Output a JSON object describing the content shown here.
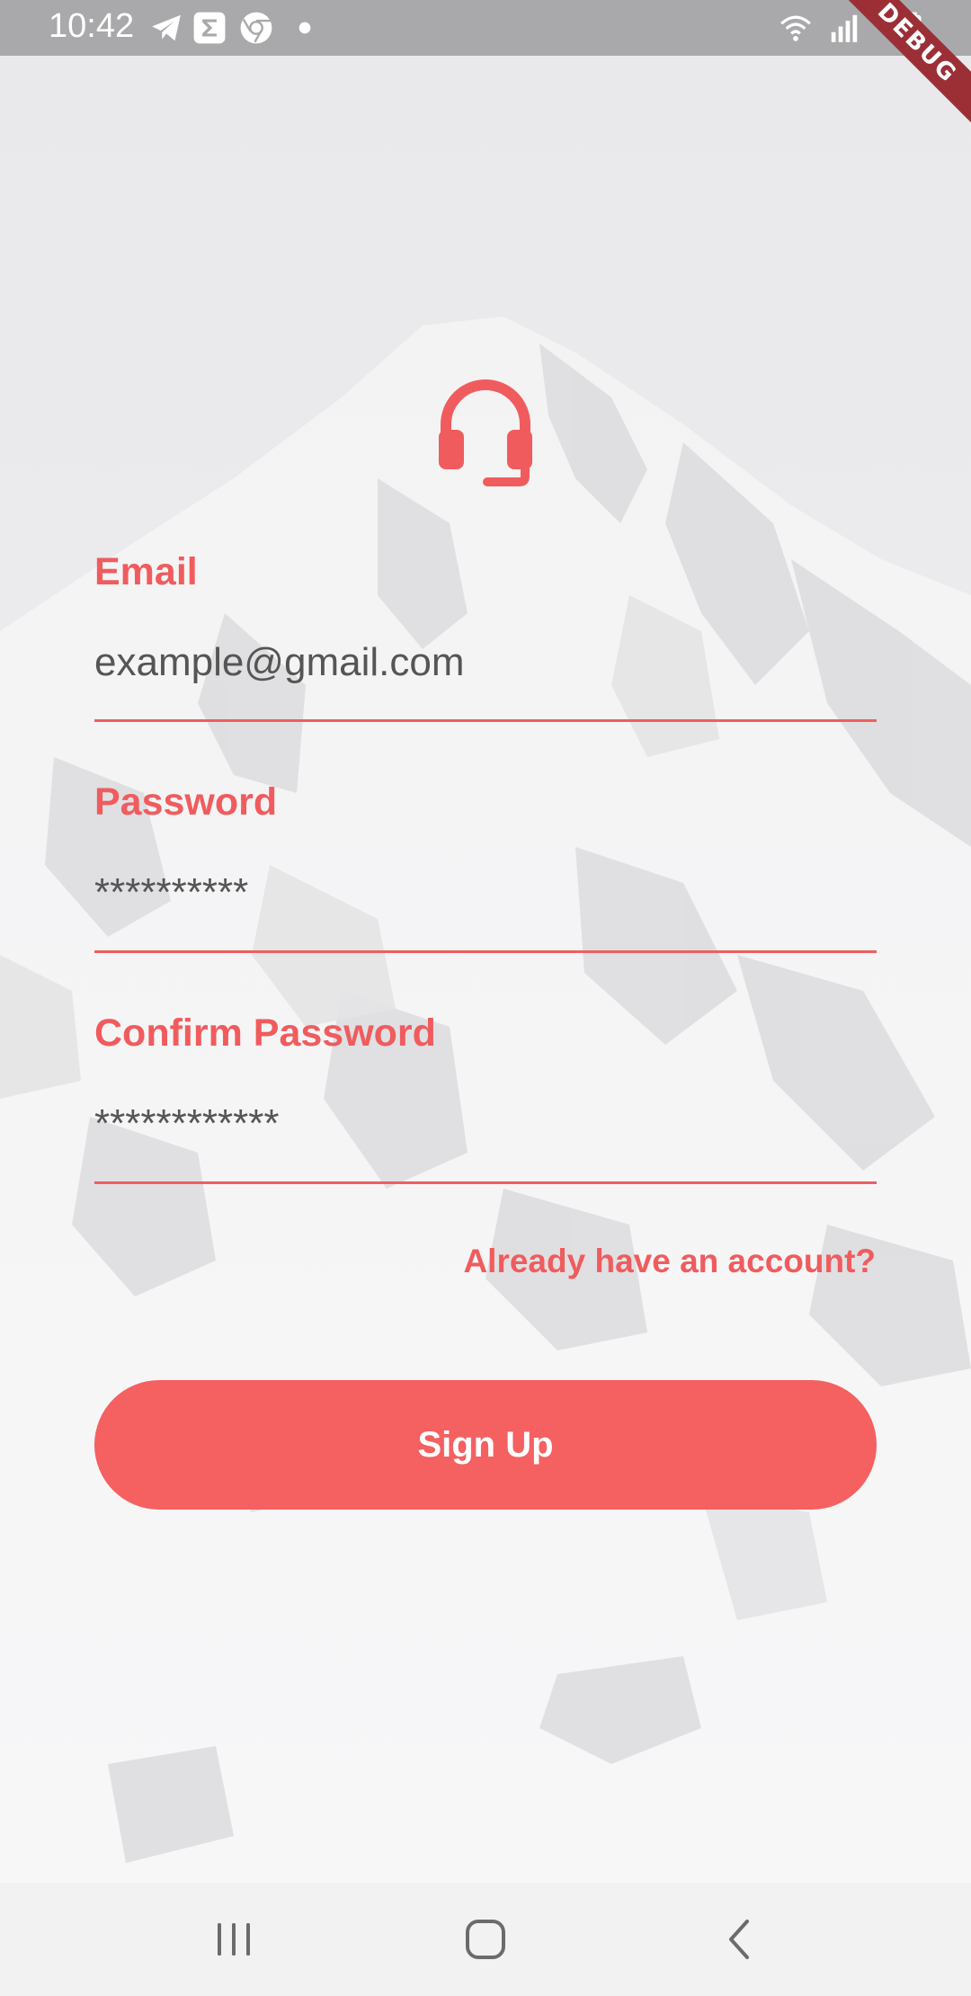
{
  "status_bar": {
    "time": "10:42",
    "icons": [
      "telegram-icon",
      "sigma-icon",
      "chrome-icon",
      "dot-icon",
      "wifi-icon",
      "signal-icon",
      "battery-charging-icon"
    ],
    "debug_banner": "DEBUG"
  },
  "logo": {
    "icon": "headset-icon",
    "color": "#f05c5e"
  },
  "form": {
    "email": {
      "label": "Email",
      "value": "example@gmail.com"
    },
    "password": {
      "label": "Password",
      "value": "**********"
    },
    "confirm_password": {
      "label": "Confirm Password",
      "value": "************"
    },
    "login_link": "Already have an account?",
    "submit_label": "Sign Up"
  },
  "nav_bar": {
    "buttons": [
      "recent-apps-icon",
      "home-icon",
      "back-icon"
    ]
  },
  "colors": {
    "accent": "#f05c5e",
    "button": "#f56060",
    "status_bar": "#a9a9ab",
    "nav_bar": "#f2f2f3"
  }
}
